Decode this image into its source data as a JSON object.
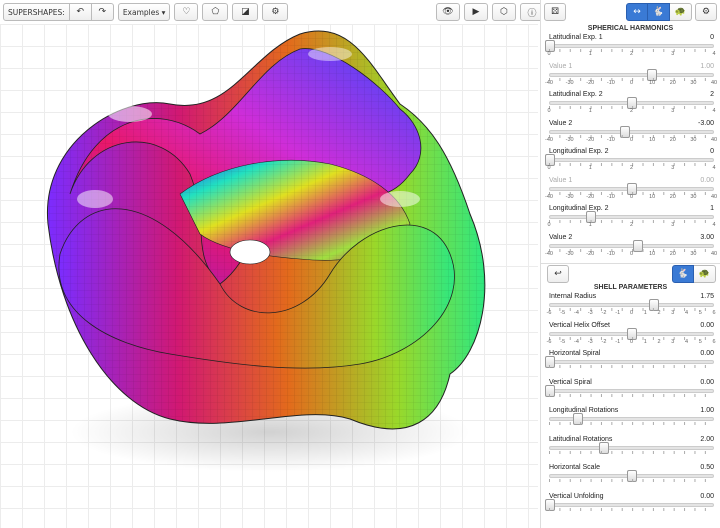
{
  "toolbar": {
    "app_label": "SUPERSHAPES:",
    "examples_label": "Examples ▾"
  },
  "harmonics": {
    "title": "SPHERICAL HARMONICS",
    "params": [
      {
        "label": "Latitudinal Exp. 1",
        "value": "0",
        "fraction": 0.0,
        "ticks": [
          "0",
          "1",
          "2",
          "3",
          "4"
        ],
        "disabled": false
      },
      {
        "label": "Value 1",
        "value": "1.00",
        "fraction": 0.625,
        "ticks": [
          "-40",
          "-30",
          "-20",
          "-10",
          "0",
          "10",
          "20",
          "30",
          "40"
        ],
        "disabled": true
      },
      {
        "label": "Latitudinal Exp. 2",
        "value": "2",
        "fraction": 0.5,
        "ticks": [
          "0",
          "1",
          "2",
          "3",
          "4"
        ],
        "disabled": false
      },
      {
        "label": "Value 2",
        "value": "-3.00",
        "fraction": 0.462,
        "ticks": [
          "-40",
          "-30",
          "-20",
          "-10",
          "0",
          "10",
          "20",
          "30",
          "40"
        ],
        "disabled": false
      },
      {
        "label": "Longitudinal Exp. 2",
        "value": "0",
        "fraction": 0.0,
        "ticks": [
          "0",
          "1",
          "2",
          "3",
          "4"
        ],
        "disabled": false
      },
      {
        "label": "Value 1",
        "value": "0.00",
        "fraction": 0.5,
        "ticks": [
          "-40",
          "-30",
          "-20",
          "-10",
          "0",
          "10",
          "20",
          "30",
          "40"
        ],
        "disabled": true
      },
      {
        "label": "Longitudinal Exp. 2",
        "value": "1",
        "fraction": 0.25,
        "ticks": [
          "0",
          "1",
          "2",
          "3",
          "4"
        ],
        "disabled": false
      },
      {
        "label": "Value 2",
        "value": "3.00",
        "fraction": 0.537,
        "ticks": [
          "-40",
          "-30",
          "-20",
          "-10",
          "0",
          "10",
          "20",
          "30",
          "40"
        ],
        "disabled": false
      }
    ]
  },
  "shell": {
    "title": "SHELL PARAMETERS",
    "params": [
      {
        "label": "Internal Radius",
        "value": "1.75",
        "fraction": 0.64,
        "ticks": [
          "-6",
          "-5",
          "-4",
          "-3",
          "-2",
          "-1",
          "0",
          "1",
          "2",
          "3",
          "4",
          "5",
          "6"
        ]
      },
      {
        "label": "Vertical Helix Offset",
        "value": "0.00",
        "fraction": 0.5,
        "ticks": [
          "-6",
          "-5",
          "-4",
          "-3",
          "-2",
          "-1",
          "0",
          "1",
          "2",
          "3",
          "4",
          "5",
          "6"
        ]
      },
      {
        "label": "Horizontal Spiral",
        "value": "0.00",
        "fraction": 0.0,
        "ticks": []
      },
      {
        "label": "Vertical Spiral",
        "value": "0.00",
        "fraction": 0.0,
        "ticks": []
      },
      {
        "label": "Longitudinal Rotations",
        "value": "1.00",
        "fraction": 0.17,
        "ticks": []
      },
      {
        "label": "Latitudinal Rotations",
        "value": "2.00",
        "fraction": 0.33,
        "ticks": []
      },
      {
        "label": "Horizontal Scale",
        "value": "0.50",
        "fraction": 0.5,
        "ticks": []
      },
      {
        "label": "Vertical Unfolding",
        "value": "0.00",
        "fraction": 0.0,
        "ticks": []
      }
    ]
  }
}
